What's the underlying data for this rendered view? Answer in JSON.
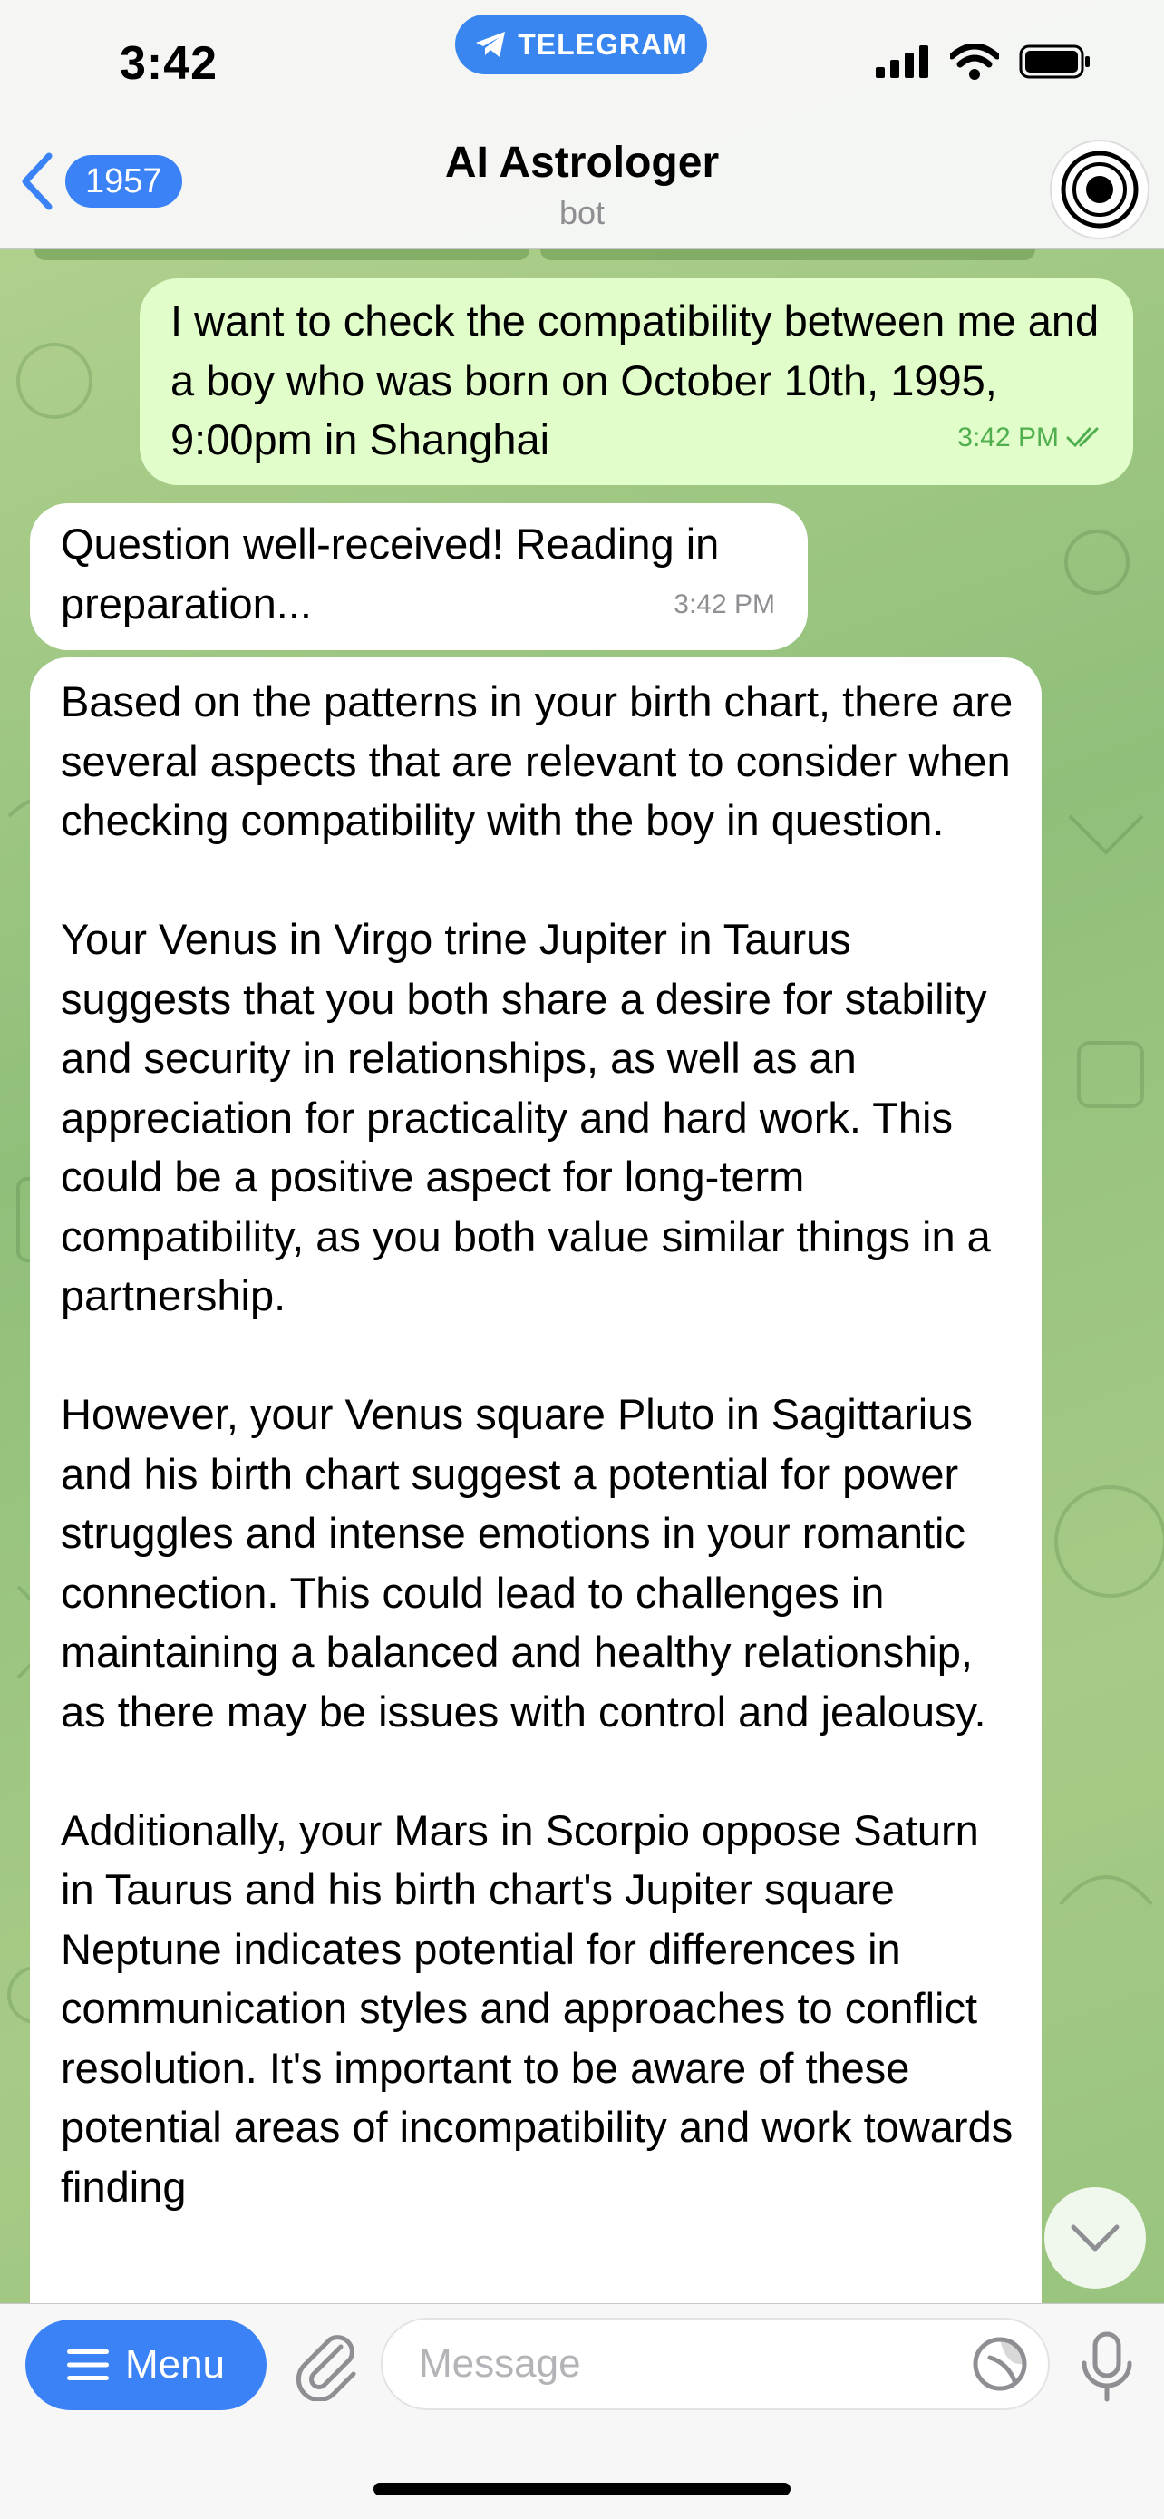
{
  "status_bar": {
    "time": "3:42",
    "app_badge": "TELEGRAM"
  },
  "header": {
    "back_count": "1957",
    "title": "AI Astrologer",
    "subtitle": "bot"
  },
  "messages": {
    "outgoing": {
      "text": "I want to check the compatibility between me and a boy who was born on October 10th, 1995, 9:00pm in Shanghai",
      "time": "3:42 PM"
    },
    "incoming_1": {
      "text": "Question well-received! Reading in preparation...",
      "time": "3:42 PM"
    },
    "incoming_2": {
      "paragraphs": [
        "Based on the patterns in your birth chart, there are several aspects that are relevant to consider when checking compatibility with the boy in question.",
        "Your Venus in Virgo trine Jupiter in Taurus suggests that you both share a desire for stability and security in relationships, as well as an appreciation for practicality and hard work. This could be a positive aspect for long-term compatibility, as you both value similar things in a partnership.",
        "However, your Venus square Pluto in Sagittarius and his birth chart suggest a potential for power struggles and intense emotions in your romantic connection. This could lead to challenges in maintaining a balanced and healthy relationship, as there may be issues with control and jealousy.",
        "Additionally, your Mars in Scorpio oppose Saturn in Taurus and his birth chart's Jupiter square Neptune indicates potential for differences in communication styles and approaches to conflict resolution. It's important to be aware of these potential areas of incompatibility and work towards finding"
      ]
    }
  },
  "input_bar": {
    "menu_label": "Menu",
    "message_placeholder": "Message"
  },
  "colors": {
    "accent": "#3b82f6",
    "outgoing_bubble": "#e1fdc9",
    "read_check": "#4fae4e"
  },
  "icons": [
    "back-chevron-icon",
    "paper-plane-icon",
    "signal-icon",
    "wifi-icon",
    "battery-icon",
    "hamburger-icon",
    "paperclip-icon",
    "sticker-icon",
    "microphone-icon",
    "chevron-down-icon",
    "double-check-icon"
  ]
}
